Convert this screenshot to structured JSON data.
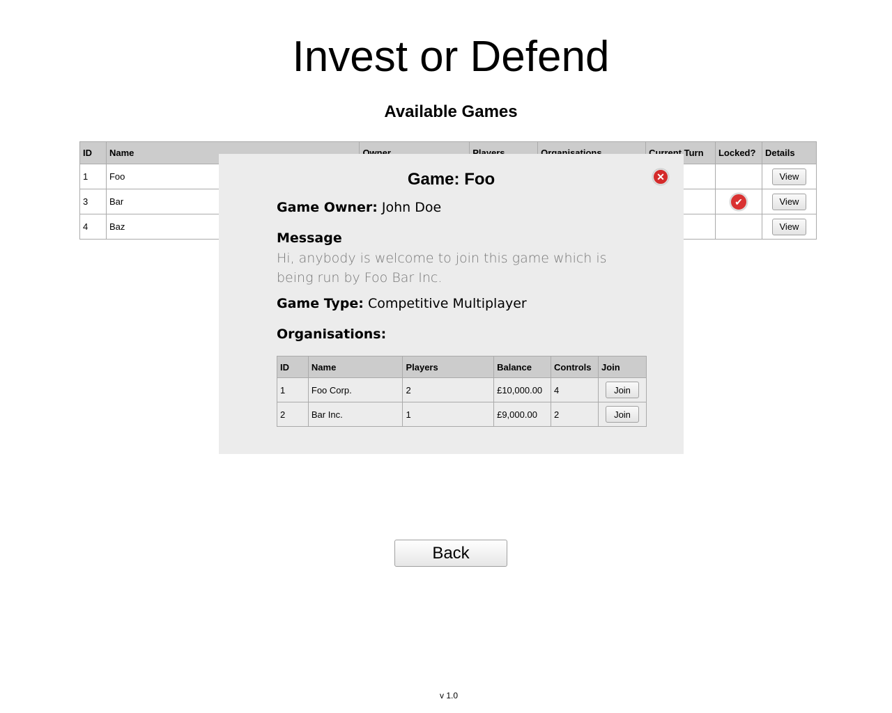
{
  "app_title": "Invest or Defend",
  "section_title": "Available Games",
  "games_table": {
    "headers": [
      "ID",
      "Name",
      "Owner",
      "Players",
      "Organisations",
      "Current Turn",
      "Locked?",
      "Details"
    ],
    "rows": [
      {
        "id": "1",
        "name": "Foo",
        "owner": "",
        "players": "",
        "organisations": "",
        "current_turn": "",
        "locked": false,
        "details_label": "View"
      },
      {
        "id": "3",
        "name": "Bar",
        "owner": "",
        "players": "",
        "organisations": "",
        "current_turn": "",
        "locked": true,
        "details_label": "View"
      },
      {
        "id": "4",
        "name": "Baz",
        "owner": "",
        "players": "",
        "organisations": "",
        "current_turn": "",
        "locked": false,
        "details_label": "View"
      }
    ]
  },
  "modal": {
    "title": "Game: Foo",
    "close_icon": "close-icon",
    "owner_label": "Game Owner:",
    "owner_value": "John Doe",
    "message_heading": "Message",
    "message_text": "Hi, anybody is welcome to join this game which is being run by Foo Bar Inc.",
    "type_label": "Game Type:",
    "type_value": "Competitive Multiplayer",
    "orgs_heading": "Organisations:",
    "orgs_table": {
      "headers": [
        "ID",
        "Name",
        "Players",
        "Balance",
        "Controls",
        "Join"
      ],
      "rows": [
        {
          "id": "1",
          "name": "Foo Corp.",
          "players": "2",
          "balance": "£10,000.00",
          "controls": "4",
          "join_label": "Join"
        },
        {
          "id": "2",
          "name": "Bar Inc.",
          "players": "1",
          "balance": "£9,000.00",
          "controls": "2",
          "join_label": "Join"
        }
      ]
    }
  },
  "back_label": "Back",
  "version": "v 1.0",
  "colors": {
    "header_bg": "#cccccc",
    "modal_bg": "#ececec",
    "badge_red": "#d93232"
  }
}
